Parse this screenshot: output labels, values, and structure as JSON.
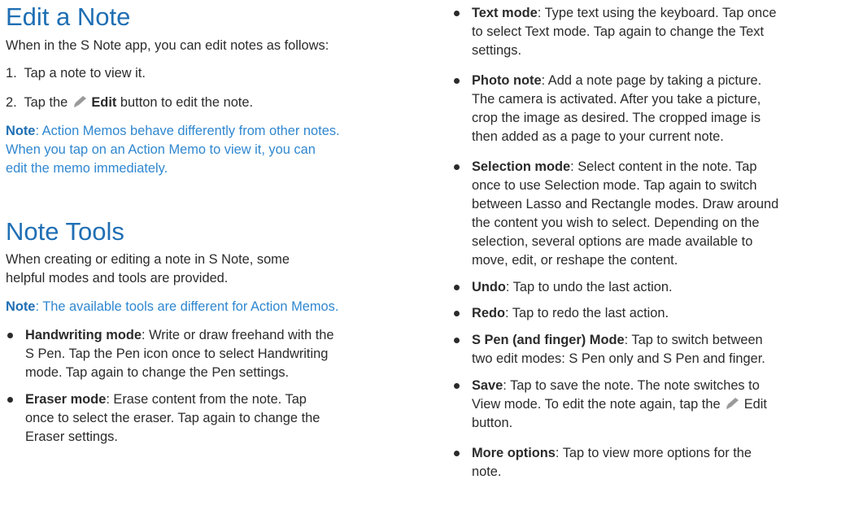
{
  "edit_note": {
    "title": "Edit a Note",
    "intro": "When in the S Note app, you can edit notes as follows:",
    "steps": [
      {
        "num": "1.",
        "text": "Tap a note to view it."
      },
      {
        "num": "2.",
        "pre": "Tap the",
        "bold": "Edit",
        "post": "button to edit the note."
      }
    ],
    "note": {
      "label": "Note",
      "line1": ": Action Memos behave differently from other notes.",
      "line2": "When you tap on an Action Memo to view it, you can",
      "line3": "edit the memo immediately."
    }
  },
  "note_tools": {
    "title": "Note Tools",
    "intro_line1": "When creating or editing a note in S Note, some",
    "intro_line2": "helpful modes and tools are provided.",
    "note": {
      "label": "Note",
      "text": ": The available tools are different for Action Memos."
    }
  },
  "tools_left": [
    {
      "term": "Handwriting mode",
      "lines": [
        ": Write or draw freehand with the",
        "S Pen. Tap the Pen icon once to select Handwriting",
        "mode. Tap again to change the Pen settings."
      ]
    },
    {
      "term": "Eraser mode",
      "lines": [
        ": Erase content from the note. Tap",
        "once to select the eraser. Tap again to change the",
        "Eraser settings."
      ]
    }
  ],
  "tools_right": [
    {
      "term": "Text mode",
      "lines": [
        ": Type text using the keyboard. Tap once",
        "to select Text mode. Tap again to change the Text",
        "settings."
      ]
    },
    {
      "term": "Photo note",
      "lines": [
        ": Add a note page by taking a picture.",
        "The camera is activated. After you take a picture,",
        "crop the image as desired. The cropped image is",
        "then added as a page to your current note."
      ]
    },
    {
      "term": "Selection mode",
      "lines": [
        ": Select content in the note. Tap",
        "once to use Selection mode. Tap again to switch",
        "between Lasso and Rectangle modes. Draw around",
        "the content you wish to select. Depending on the",
        "selection, several options are made available to",
        "move, edit, or reshape the content."
      ]
    },
    {
      "term": "Undo",
      "lines": [
        ": Tap to undo the last action."
      ]
    },
    {
      "term": "Redo",
      "lines": [
        ": Tap to redo the last action."
      ]
    },
    {
      "term": "S Pen (and finger) Mode",
      "lines": [
        ": Tap to switch between",
        "two edit modes: S Pen only and S Pen and finger."
      ]
    },
    {
      "term": "Save",
      "lines": [
        ": Tap to save the note. The note switches to",
        "View mode. To edit the note again, tap the",
        "button."
      ],
      "inline_edit": "Edit"
    },
    {
      "term": "More options",
      "lines": [
        ": Tap to view more options for the",
        "note."
      ]
    }
  ],
  "colors": {
    "heading": "#1f6fb4",
    "note_text": "#2f87d0",
    "body_text": "#2b2b2b",
    "icon": "#9a9a9a"
  }
}
